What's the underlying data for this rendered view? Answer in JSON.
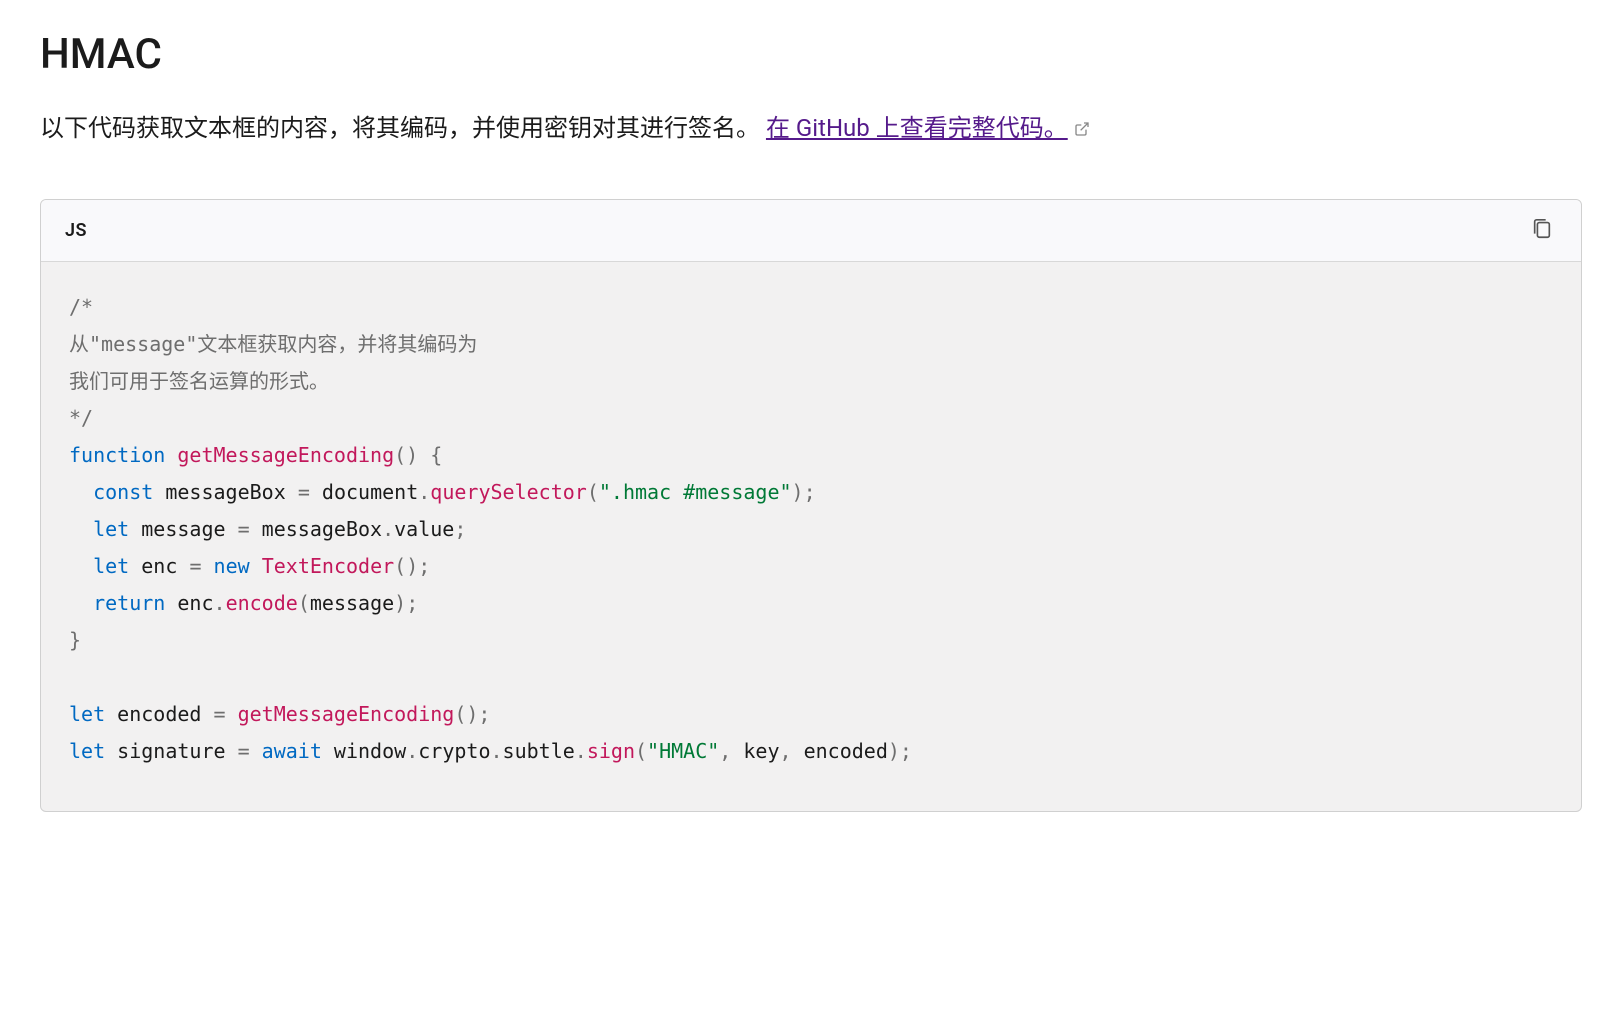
{
  "heading": "HMAC",
  "description": {
    "text_before_link": "以下代码获取文本框的内容，将其编码，并使用密钥对其进行签名。",
    "link_text": "在 GitHub 上查看完整代码。"
  },
  "code": {
    "language_label": "JS",
    "tokens": [
      {
        "cls": "tok-comment",
        "t": "/*"
      },
      {
        "cls": "newline"
      },
      {
        "cls": "tok-comment",
        "t": "从\"message\"文本框获取内容，并将其编码为"
      },
      {
        "cls": "newline"
      },
      {
        "cls": "tok-comment",
        "t": "我们可用于签名运算的形式。"
      },
      {
        "cls": "newline"
      },
      {
        "cls": "tok-comment",
        "t": "*/"
      },
      {
        "cls": "newline"
      },
      {
        "cls": "tok-keyword",
        "t": "function"
      },
      {
        "cls": "tok-plain",
        "t": " "
      },
      {
        "cls": "tok-function-name",
        "t": "getMessageEncoding"
      },
      {
        "cls": "tok-punct",
        "t": "()"
      },
      {
        "cls": "tok-plain",
        "t": " "
      },
      {
        "cls": "tok-punct",
        "t": "{"
      },
      {
        "cls": "newline"
      },
      {
        "cls": "tok-plain",
        "t": "  "
      },
      {
        "cls": "tok-keyword",
        "t": "const"
      },
      {
        "cls": "tok-plain",
        "t": " messageBox "
      },
      {
        "cls": "tok-operator",
        "t": "="
      },
      {
        "cls": "tok-plain",
        "t": " document"
      },
      {
        "cls": "tok-punct",
        "t": "."
      },
      {
        "cls": "tok-method",
        "t": "querySelector"
      },
      {
        "cls": "tok-punct",
        "t": "("
      },
      {
        "cls": "tok-string",
        "t": "\".hmac #message\""
      },
      {
        "cls": "tok-punct",
        "t": ");"
      },
      {
        "cls": "newline"
      },
      {
        "cls": "tok-plain",
        "t": "  "
      },
      {
        "cls": "tok-keyword",
        "t": "let"
      },
      {
        "cls": "tok-plain",
        "t": " message "
      },
      {
        "cls": "tok-operator",
        "t": "="
      },
      {
        "cls": "tok-plain",
        "t": " messageBox"
      },
      {
        "cls": "tok-punct",
        "t": "."
      },
      {
        "cls": "tok-plain",
        "t": "value"
      },
      {
        "cls": "tok-punct",
        "t": ";"
      },
      {
        "cls": "newline"
      },
      {
        "cls": "tok-plain",
        "t": "  "
      },
      {
        "cls": "tok-keyword",
        "t": "let"
      },
      {
        "cls": "tok-plain",
        "t": " enc "
      },
      {
        "cls": "tok-operator",
        "t": "="
      },
      {
        "cls": "tok-plain",
        "t": " "
      },
      {
        "cls": "tok-keyword",
        "t": "new"
      },
      {
        "cls": "tok-plain",
        "t": " "
      },
      {
        "cls": "tok-class-name",
        "t": "TextEncoder"
      },
      {
        "cls": "tok-punct",
        "t": "();"
      },
      {
        "cls": "newline"
      },
      {
        "cls": "tok-plain",
        "t": "  "
      },
      {
        "cls": "tok-keyword",
        "t": "return"
      },
      {
        "cls": "tok-plain",
        "t": " enc"
      },
      {
        "cls": "tok-punct",
        "t": "."
      },
      {
        "cls": "tok-method",
        "t": "encode"
      },
      {
        "cls": "tok-punct",
        "t": "("
      },
      {
        "cls": "tok-plain",
        "t": "message"
      },
      {
        "cls": "tok-punct",
        "t": ");"
      },
      {
        "cls": "newline"
      },
      {
        "cls": "tok-punct",
        "t": "}"
      },
      {
        "cls": "newline"
      },
      {
        "cls": "newline"
      },
      {
        "cls": "tok-keyword",
        "t": "let"
      },
      {
        "cls": "tok-plain",
        "t": " encoded "
      },
      {
        "cls": "tok-operator",
        "t": "="
      },
      {
        "cls": "tok-plain",
        "t": " "
      },
      {
        "cls": "tok-method",
        "t": "getMessageEncoding"
      },
      {
        "cls": "tok-punct",
        "t": "();"
      },
      {
        "cls": "newline"
      },
      {
        "cls": "tok-keyword",
        "t": "let"
      },
      {
        "cls": "tok-plain",
        "t": " signature "
      },
      {
        "cls": "tok-operator",
        "t": "="
      },
      {
        "cls": "tok-plain",
        "t": " "
      },
      {
        "cls": "tok-keyword",
        "t": "await"
      },
      {
        "cls": "tok-plain",
        "t": " window"
      },
      {
        "cls": "tok-punct",
        "t": "."
      },
      {
        "cls": "tok-plain",
        "t": "crypto"
      },
      {
        "cls": "tok-punct",
        "t": "."
      },
      {
        "cls": "tok-plain",
        "t": "subtle"
      },
      {
        "cls": "tok-punct",
        "t": "."
      },
      {
        "cls": "tok-method",
        "t": "sign"
      },
      {
        "cls": "tok-punct",
        "t": "("
      },
      {
        "cls": "tok-string",
        "t": "\"HMAC\""
      },
      {
        "cls": "tok-punct",
        "t": ","
      },
      {
        "cls": "tok-plain",
        "t": " key"
      },
      {
        "cls": "tok-punct",
        "t": ","
      },
      {
        "cls": "tok-plain",
        "t": " encoded"
      },
      {
        "cls": "tok-punct",
        "t": ");"
      }
    ]
  }
}
